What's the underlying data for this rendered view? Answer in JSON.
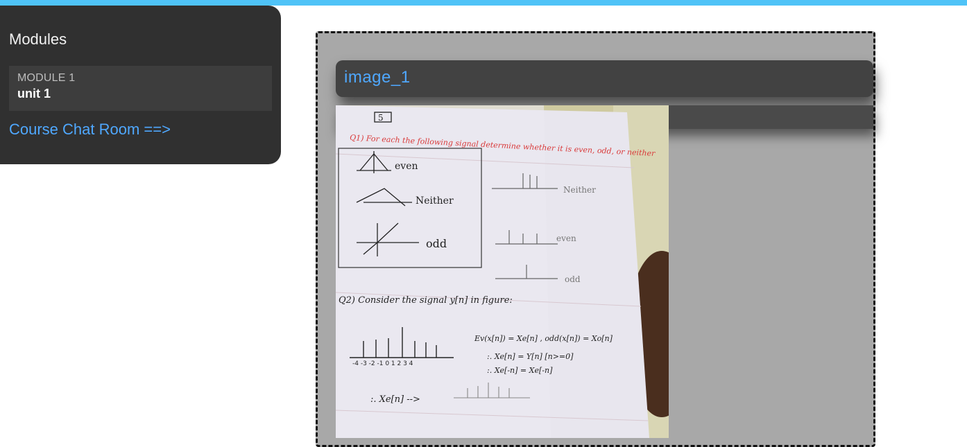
{
  "colors": {
    "accent_bar": "#4fc3f7",
    "link": "#4fa8ff",
    "sidebar_bg": "#303030",
    "frame_bg": "#a8a8a8"
  },
  "sidebar": {
    "title": "Modules",
    "module": {
      "label": "MODULE 1",
      "unit": "unit 1"
    },
    "chat_link": "Course Chat Room ==>"
  },
  "main": {
    "image_title": "image_1",
    "image_alt": "handwritten notes photo"
  },
  "notes": {
    "page_number": "5",
    "question_1": "Q1) For each the following signal determine whether it is even, odd, or neither",
    "answers": [
      "even",
      "Neither",
      "odd",
      "Neither",
      "even",
      "odd"
    ],
    "question_2": "Q2) Consider the signal y[n] in figure:",
    "eq_1": "Ev(x[n]) = Xe[n] , odd(x[n]) = Xo[n]",
    "eq_2": ":. Xe[n] = Y[n]  [n>=0]",
    "eq_3": ":. Xe[-n] = Xe[-n]",
    "eq_4": ":. Xe[n] -->",
    "axis_ticks": "-4 -3 -2 -1 0 1 2 3 4"
  }
}
